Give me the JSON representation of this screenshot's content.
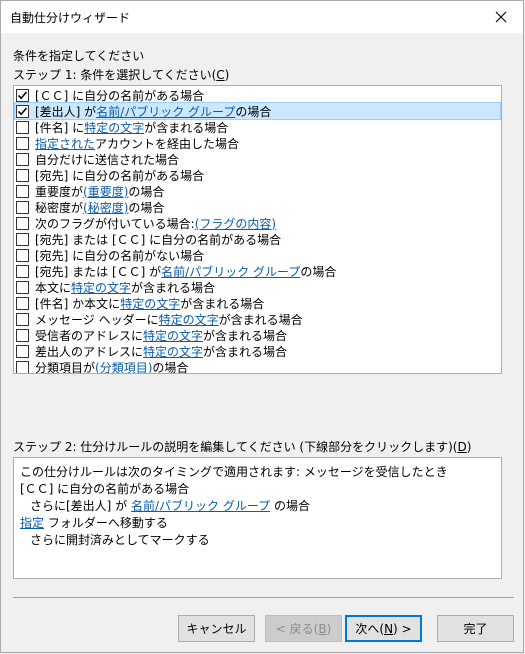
{
  "window": {
    "title": "自動仕分けウィザード"
  },
  "prompt": "条件を指定してください",
  "step1": {
    "label": "ステップ 1: 条件を選択してください(",
    "key": "C",
    "close": ")"
  },
  "conditions": [
    {
      "checked": true,
      "selected": false,
      "parts": [
        {
          "t": "[ＣＣ] に自分の名前がある場合"
        }
      ]
    },
    {
      "checked": true,
      "selected": true,
      "parts": [
        {
          "t": "[差出人] が "
        },
        {
          "t": "名前/パブリック グループ",
          "link": true
        },
        {
          "t": " の場合"
        }
      ]
    },
    {
      "checked": false,
      "selected": false,
      "parts": [
        {
          "t": "[件名] に "
        },
        {
          "t": "特定の文字",
          "link": true
        },
        {
          "t": " が含まれる場合"
        }
      ]
    },
    {
      "checked": false,
      "selected": false,
      "parts": [
        {
          "t": "指定された",
          "link": true
        },
        {
          "t": " アカウントを経由した場合"
        }
      ]
    },
    {
      "checked": false,
      "selected": false,
      "parts": [
        {
          "t": "自分だけに送信された場合"
        }
      ]
    },
    {
      "checked": false,
      "selected": false,
      "parts": [
        {
          "t": "[宛先] に自分の名前がある場合"
        }
      ]
    },
    {
      "checked": false,
      "selected": false,
      "parts": [
        {
          "t": "重要度が "
        },
        {
          "t": "(重要度)",
          "link": true
        },
        {
          "t": " の場合"
        }
      ]
    },
    {
      "checked": false,
      "selected": false,
      "parts": [
        {
          "t": "秘密度が "
        },
        {
          "t": "(秘密度)",
          "link": true
        },
        {
          "t": " の場合"
        }
      ]
    },
    {
      "checked": false,
      "selected": false,
      "parts": [
        {
          "t": "次のフラグが付いている場合: "
        },
        {
          "t": "(フラグの内容)",
          "link": true
        }
      ]
    },
    {
      "checked": false,
      "selected": false,
      "parts": [
        {
          "t": "[宛先] または [ＣＣ] に自分の名前がある場合"
        }
      ]
    },
    {
      "checked": false,
      "selected": false,
      "parts": [
        {
          "t": "[宛先] に自分の名前がない場合"
        }
      ]
    },
    {
      "checked": false,
      "selected": false,
      "parts": [
        {
          "t": "[宛先] または [ＣＣ] が "
        },
        {
          "t": "名前/パブリック グループ",
          "link": true
        },
        {
          "t": " の場合"
        }
      ]
    },
    {
      "checked": false,
      "selected": false,
      "parts": [
        {
          "t": "本文に "
        },
        {
          "t": "特定の文字",
          "link": true
        },
        {
          "t": " が含まれる場合"
        }
      ]
    },
    {
      "checked": false,
      "selected": false,
      "parts": [
        {
          "t": "[件名] か本文に "
        },
        {
          "t": "特定の文字",
          "link": true
        },
        {
          "t": " が含まれる場合"
        }
      ]
    },
    {
      "checked": false,
      "selected": false,
      "parts": [
        {
          "t": "メッセージ ヘッダーに "
        },
        {
          "t": "特定の文字",
          "link": true
        },
        {
          "t": " が含まれる場合"
        }
      ]
    },
    {
      "checked": false,
      "selected": false,
      "parts": [
        {
          "t": "受信者のアドレスに "
        },
        {
          "t": "特定の文字",
          "link": true
        },
        {
          "t": " が含まれる場合"
        }
      ]
    },
    {
      "checked": false,
      "selected": false,
      "parts": [
        {
          "t": "差出人のアドレスに "
        },
        {
          "t": "特定の文字",
          "link": true
        },
        {
          "t": " が含まれる場合"
        }
      ]
    },
    {
      "checked": false,
      "selected": false,
      "parts": [
        {
          "t": "分類項目が "
        },
        {
          "t": "(分類項目)",
          "link": true
        },
        {
          "t": " の場合"
        }
      ]
    }
  ],
  "step2": {
    "label": "ステップ 2: 仕分けルールの説明を編集してください (下線部分をクリックします)(",
    "key": "D",
    "close": ")"
  },
  "description": [
    {
      "indent": 0,
      "parts": [
        {
          "t": "この仕分けルールは次のタイミングで適用されます: メッセージを受信したとき"
        }
      ]
    },
    {
      "indent": 0,
      "parts": [
        {
          "t": "[ＣＣ] に自分の名前がある場合"
        }
      ]
    },
    {
      "indent": 1,
      "parts": [
        {
          "t": "さらに[差出人] が "
        },
        {
          "t": "名前/パブリック グループ",
          "link": true
        },
        {
          "t": " の場合"
        }
      ]
    },
    {
      "indent": 0,
      "parts": [
        {
          "t": "指定",
          "link": true
        },
        {
          "t": " フォルダーへ移動する"
        }
      ]
    },
    {
      "indent": 1,
      "parts": [
        {
          "t": "さらに開封済みとしてマークする"
        }
      ]
    }
  ],
  "buttons": {
    "cancel": "キャンセル",
    "back_pre": "< 戻る(",
    "back_key": "B",
    "back_post": ")",
    "next_pre": "次へ(",
    "next_key": "N",
    "next_post": ") >",
    "finish": "完了"
  }
}
